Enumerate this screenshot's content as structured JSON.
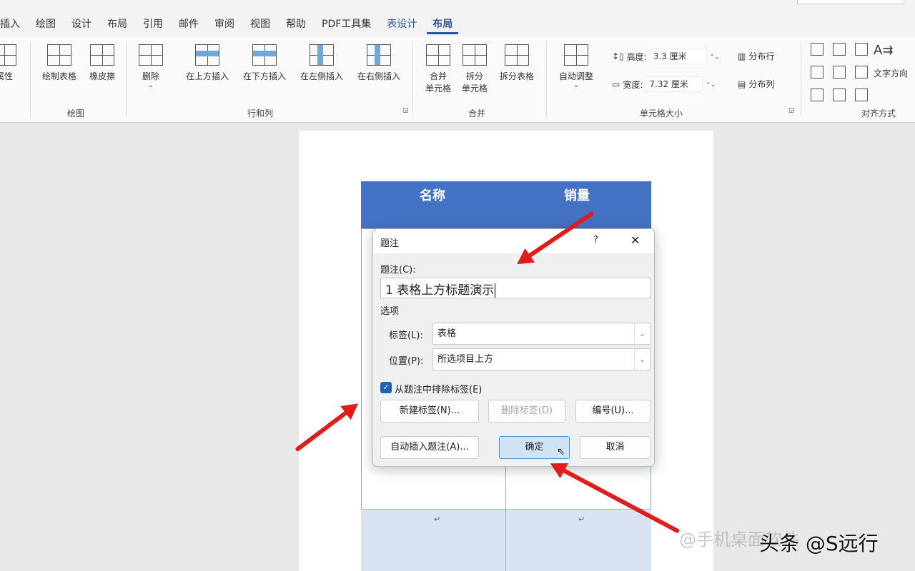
{
  "tabs": [
    "插入",
    "绘图",
    "设计",
    "布局",
    "引用",
    "邮件",
    "审阅",
    "视图",
    "帮助",
    "PDF工具集",
    "表设计",
    "布局"
  ],
  "ribbon": {
    "properties": "属性",
    "draw_table": "绘制表格",
    "eraser": "橡皮擦",
    "delete": "删除",
    "insert_above": "在上方插入",
    "insert_below": "在下方插入",
    "insert_left": "在左侧插入",
    "insert_right": "在右侧插入",
    "merge_cells": [
      "合并",
      "单元格"
    ],
    "split_cells": [
      "拆分",
      "单元格"
    ],
    "split_table": "拆分表格",
    "autofit": "自动调整",
    "height_label": "高度:",
    "height_value": "3.3 厘米",
    "width_label": "宽度:",
    "width_value": "7.32 厘米",
    "distribute_rows": "分布行",
    "distribute_cols": "分布列",
    "text_direction": "文字方向",
    "groups": {
      "draw": "绘图",
      "rows_cols": "行和列",
      "merge": "合并",
      "cell_size": "单元格大小",
      "alignment": "对齐方式"
    }
  },
  "table": {
    "headers": [
      "名称",
      "销量"
    ],
    "para_mark": "↵"
  },
  "dialog": {
    "title": "题注",
    "help": "?",
    "close": "✕",
    "caption_label": "题注(C):",
    "caption_value": "1 表格上方标题演示",
    "options_label": "选项",
    "label_label": "标签(L):",
    "label_value": "表格",
    "position_label": "位置(P):",
    "position_value": "所选项目上方",
    "exclude_label": "从题注中排除标签(E)",
    "exclude_checked": true,
    "new_label": "新建标签(N)...",
    "delete_label": "删除标签(D)",
    "numbering": "编号(U)...",
    "autocaption": "自动插入题注(A)...",
    "ok": "确定",
    "cancel": "取消"
  },
  "watermark": "@手机桌面软件",
  "credit": "头条 @S远行",
  "colors": {
    "accent": "#2f5597",
    "table_header": "#4472c4",
    "arrow": "#e21b1b"
  }
}
